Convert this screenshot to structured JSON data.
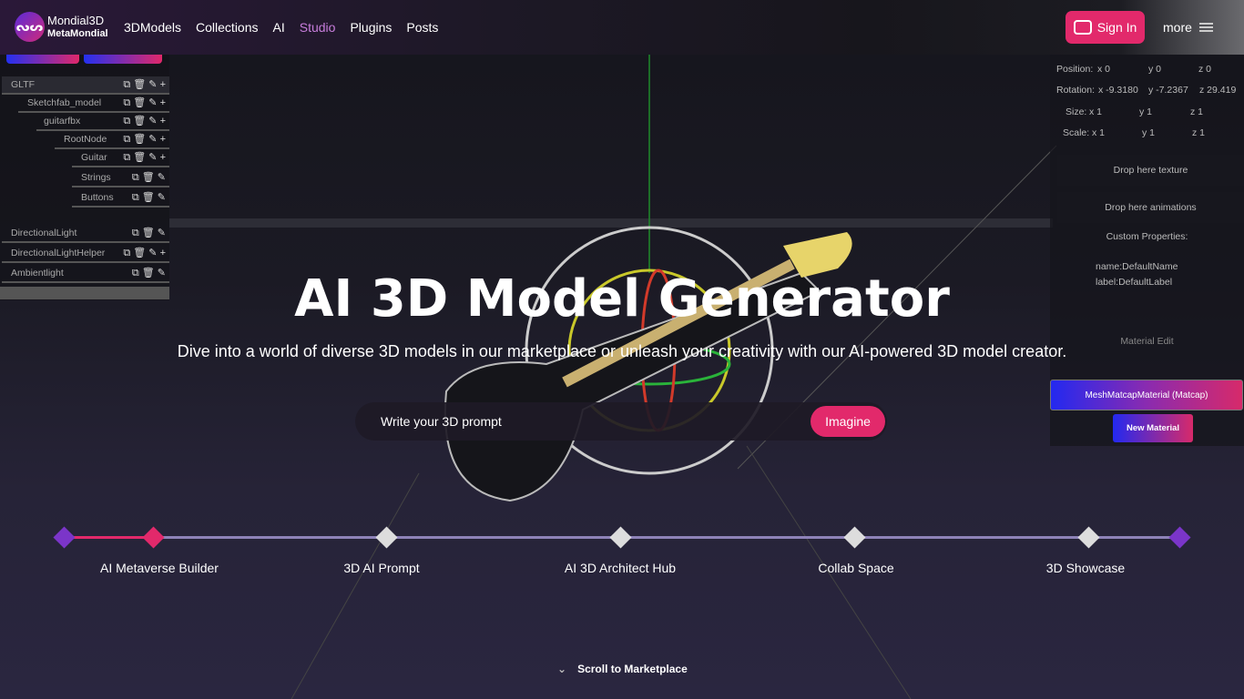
{
  "nav": {
    "logo_top": "Mondial3D",
    "logo_bottom": "MetaMondial",
    "items": [
      "3DModels",
      "Collections",
      "AI",
      "Studio",
      "Plugins",
      "Posts"
    ],
    "active": "Studio",
    "sign_in": "Sign In",
    "more": "more"
  },
  "tree": {
    "nodes": [
      "GLTF",
      "Sketchfab_model",
      "guitarfbx",
      "RootNode",
      "Guitar",
      "Strings",
      "Buttons",
      "DirectionalLight",
      "DirectionalLightHelper",
      "Ambientlight"
    ]
  },
  "props": {
    "position": {
      "label": "Position:",
      "x": "x 0",
      "y": "y 0",
      "z": "z 0"
    },
    "rotation": {
      "label": "Rotation:",
      "x": "x -9.3180",
      "y": "y -7.2367",
      "z": "z 29.419"
    },
    "size": {
      "label": "Size:",
      "x": "x 1",
      "y": "y 1",
      "z": "z 1"
    },
    "scale": {
      "label": "Scale:",
      "x": "x 1",
      "y": "y 1",
      "z": "z 1"
    },
    "drop_texture": "Drop here texture",
    "drop_animations": "Drop here animations",
    "custom_title": "Custom Properties:",
    "custom_name": "name:DefaultName",
    "custom_label": "label:DefaultLabel",
    "material_edit": "Material Edit",
    "material": "MeshMatcapMaterial (Matcap)",
    "new_material": "New Material"
  },
  "hero": {
    "title": "AI 3D Model Generator",
    "subtitle": "Dive into a world of diverse 3D models in our marketplace or unleash your creativity with our AI-powered 3D model creator.",
    "prompt_placeholder": "Write your 3D prompt",
    "imagine": "Imagine"
  },
  "timeline": {
    "steps": [
      "AI Metaverse Builder",
      "3D AI Prompt",
      "AI 3D Architect Hub",
      "Collab Space",
      "3D Showcase"
    ],
    "active_index": 0
  },
  "scroll": "Scroll to Marketplace",
  "colors": {
    "accent": "#e2296b",
    "active_nav": "#c77ddb",
    "purple": "#7b35c9"
  }
}
